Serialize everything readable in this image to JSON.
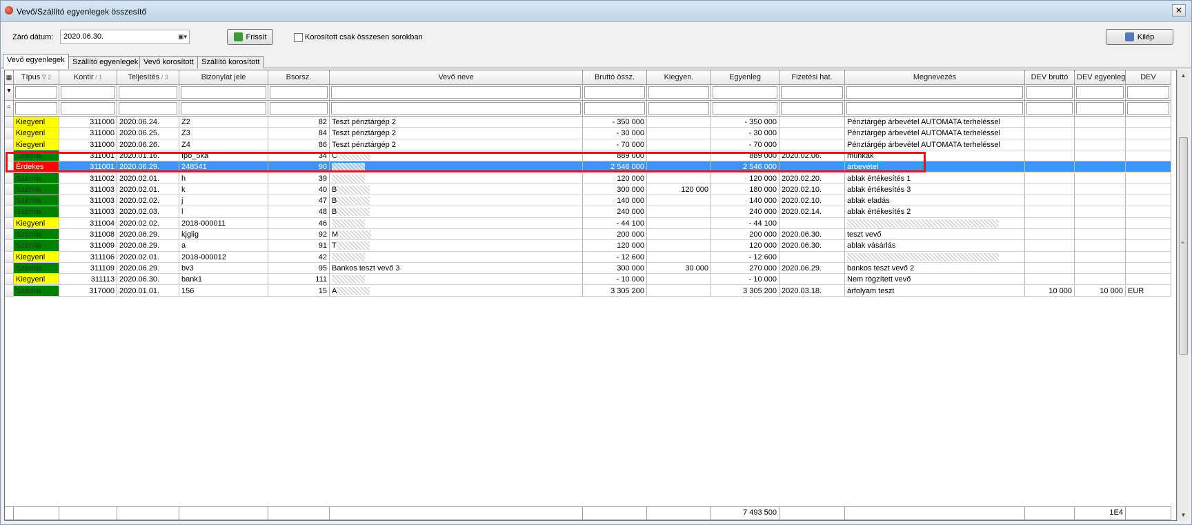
{
  "window": {
    "title": "Vevő/Szállító egyenlegek összesítő",
    "close": "✕"
  },
  "toolbar": {
    "date_label": "Záró dátum:",
    "date_value": "2020.06.30.",
    "refresh_label": "Frissít",
    "aged_only_label": "Korosított csak összesen sorokban",
    "exit_label": "Kilép"
  },
  "tabs": [
    "Vevő egyenlegek",
    "Szállító egyenlegek",
    "Vevő korosított",
    "Szállító korosított"
  ],
  "grid": {
    "columns": [
      {
        "label": "Típus",
        "sort": "∇ 2"
      },
      {
        "label": "Kontir",
        "sort": "/ 1"
      },
      {
        "label": "Teljesítés",
        "sort": "/ 3"
      },
      {
        "label": "Bizonylat jele",
        "sort": ""
      },
      {
        "label": "Bsorsz.",
        "sort": ""
      },
      {
        "label": "Vevő neve",
        "sort": ""
      },
      {
        "label": "Bruttó össz.",
        "sort": ""
      },
      {
        "label": "Kiegyen.",
        "sort": ""
      },
      {
        "label": "Egyenleg",
        "sort": ""
      },
      {
        "label": "Fizetési hat.",
        "sort": ""
      },
      {
        "label": "Megnevezés",
        "sort": ""
      },
      {
        "label": "DEV bruttó",
        "sort": ""
      },
      {
        "label": "DEV egyenleg",
        "sort": ""
      },
      {
        "label": "DEV",
        "sort": ""
      }
    ],
    "rows": [
      {
        "type": "Kiegyenl",
        "kind": "kiegyenl",
        "kontir": "311000",
        "date": "2020.06.24.",
        "doc": "Z2",
        "bsorsz": "82",
        "customer": "Teszt pénztárgép 2",
        "brutto": "- 350 000",
        "kiegyen": "",
        "egyenleg": "- 350 000",
        "due": "",
        "desc": "Pénztárgép árbevétel AUTOMATA terheléssel",
        "dev_brutto": "",
        "dev_egyenleg": "",
        "dev": ""
      },
      {
        "type": "Kiegyenl",
        "kind": "kiegyenl",
        "kontir": "311000",
        "date": "2020.06.25.",
        "doc": "Z3",
        "bsorsz": "84",
        "customer": "Teszt pénztárgép 2",
        "brutto": "- 30 000",
        "kiegyen": "",
        "egyenleg": "- 30 000",
        "due": "",
        "desc": "Pénztárgép árbevétel AUTOMATA terheléssel",
        "dev_brutto": "",
        "dev_egyenleg": "",
        "dev": ""
      },
      {
        "type": "Kiegyenl",
        "kind": "kiegyenl",
        "kontir": "311000",
        "date": "2020.06.26.",
        "doc": "Z4",
        "bsorsz": "86",
        "customer": "Teszt pénztárgép 2",
        "brutto": "- 70 000",
        "kiegyen": "",
        "egyenleg": "- 70 000",
        "due": "",
        "desc": "Pénztárgép árbevétel AUTOMATA terheléssel",
        "dev_brutto": "",
        "dev_egyenleg": "",
        "dev": ""
      },
      {
        "type": "Számla",
        "kind": "szamla",
        "kontir": "311001",
        "date": "2020.01.16.",
        "doc": "Ipo_5ka",
        "bsorsz": "34",
        "customer": "C",
        "brutto": "889 000",
        "kiegyen": "",
        "egyenleg": "889 000",
        "due": "2020.02.06.",
        "desc": "munkák",
        "dev_brutto": "",
        "dev_egyenleg": "",
        "dev": ""
      },
      {
        "type": "Érdekes",
        "kind": "erdekes",
        "selected": true,
        "kontir": "311001",
        "date": "2020.06.29.",
        "doc": "248541",
        "bsorsz": "90",
        "customer": "",
        "brutto": "2 546 000",
        "kiegyen": "",
        "egyenleg": "2 546 000",
        "due": "",
        "desc": "árbevétel",
        "dev_brutto": "",
        "dev_egyenleg": "",
        "dev": ""
      },
      {
        "type": "Számla",
        "kind": "szamla",
        "kontir": "311002",
        "date": "2020.02.01.",
        "doc": "h",
        "bsorsz": "39",
        "customer": "",
        "brutto": "120 000",
        "kiegyen": "",
        "egyenleg": "120 000",
        "due": "2020.02.20.",
        "desc": "ablak értékesítés 1",
        "dev_brutto": "",
        "dev_egyenleg": "",
        "dev": ""
      },
      {
        "type": "Számla",
        "kind": "szamla",
        "kontir": "311003",
        "date": "2020.02.01.",
        "doc": "k",
        "bsorsz": "40",
        "customer": "B",
        "brutto": "300 000",
        "kiegyen": "120 000",
        "egyenleg": "180 000",
        "due": "2020.02.10.",
        "desc": "ablak értékesítés 3",
        "dev_brutto": "",
        "dev_egyenleg": "",
        "dev": ""
      },
      {
        "type": "Számla",
        "kind": "szamla",
        "kontir": "311003",
        "date": "2020.02.02.",
        "doc": "j",
        "bsorsz": "47",
        "customer": "B",
        "brutto": "140 000",
        "kiegyen": "",
        "egyenleg": "140 000",
        "due": "2020.02.10.",
        "desc": "ablak eladás",
        "dev_brutto": "",
        "dev_egyenleg": "",
        "dev": ""
      },
      {
        "type": "Számla",
        "kind": "szamla",
        "kontir": "311003",
        "date": "2020.02.03.",
        "doc": "l",
        "bsorsz": "48",
        "customer": "B",
        "brutto": "240 000",
        "kiegyen": "",
        "egyenleg": "240 000",
        "due": "2020.02.14.",
        "desc": "ablak értékesítés 2",
        "dev_brutto": "",
        "dev_egyenleg": "",
        "dev": ""
      },
      {
        "type": "Kiegyenl",
        "kind": "kiegyenl",
        "kontir": "311004",
        "date": "2020.02.02.",
        "doc": "2018-000011",
        "bsorsz": "46",
        "customer": "",
        "brutto": "- 44 100",
        "kiegyen": "",
        "egyenleg": "- 44 100",
        "due": "",
        "desc": "",
        "desc_blur": true,
        "dev_brutto": "",
        "dev_egyenleg": "",
        "dev": ""
      },
      {
        "type": "Számla",
        "kind": "szamla",
        "kontir": "311008",
        "date": "2020.06.29.",
        "doc": "kjglig",
        "bsorsz": "92",
        "customer": "M",
        "brutto": "200 000",
        "kiegyen": "",
        "egyenleg": "200 000",
        "due": "2020.06.30.",
        "desc": "teszt vevő",
        "dev_brutto": "",
        "dev_egyenleg": "",
        "dev": ""
      },
      {
        "type": "Számla",
        "kind": "szamla",
        "kontir": "311009",
        "date": "2020.06.29.",
        "doc": "a",
        "bsorsz": "91",
        "customer": "T",
        "brutto": "120 000",
        "kiegyen": "",
        "egyenleg": "120 000",
        "due": "2020.06.30.",
        "desc": "ablak vásárlás",
        "dev_brutto": "",
        "dev_egyenleg": "",
        "dev": ""
      },
      {
        "type": "Kiegyenl",
        "kind": "kiegyenl",
        "kontir": "311106",
        "date": "2020.02.01.",
        "doc": "2018-000012",
        "bsorsz": "42",
        "customer": "",
        "brutto": "- 12 600",
        "kiegyen": "",
        "egyenleg": "- 12 600",
        "due": "",
        "desc": "",
        "desc_blur": true,
        "dev_brutto": "",
        "dev_egyenleg": "",
        "dev": ""
      },
      {
        "type": "Számla",
        "kind": "szamla",
        "kontir": "311109",
        "date": "2020.06.29.",
        "doc": "bv3",
        "bsorsz": "95",
        "customer": "Bankos teszt vevő 3",
        "brutto": "300 000",
        "kiegyen": "30 000",
        "egyenleg": "270 000",
        "due": "2020.06.29.",
        "desc": "bankos teszt vevő 2",
        "dev_brutto": "",
        "dev_egyenleg": "",
        "dev": ""
      },
      {
        "type": "Kiegyenl",
        "kind": "kiegyenl",
        "kontir": "311113",
        "date": "2020.06.30.",
        "doc": "bank1",
        "bsorsz": "111",
        "customer": "",
        "brutto": "- 10 000",
        "kiegyen": "",
        "egyenleg": "- 10 000",
        "due": "",
        "desc": "Nem rögzített vevő",
        "dev_brutto": "",
        "dev_egyenleg": "",
        "dev": ""
      },
      {
        "type": "Számla",
        "kind": "szamla",
        "kontir": "317000",
        "date": "2020.01.01.",
        "doc": "156",
        "bsorsz": "15",
        "customer": "A",
        "brutto": "3 305 200",
        "kiegyen": "",
        "egyenleg": "3 305 200",
        "due": "2020.03.18.",
        "desc": "árfolyam teszt",
        "dev_brutto": "10 000",
        "dev_egyenleg": "10 000",
        "dev": "EUR"
      }
    ],
    "footer": {
      "egyenleg_total": "7 493 500",
      "dev_egyenleg_total": "1E4"
    }
  },
  "colors": {
    "kiegyenl": "#ffff00",
    "szamla": "#008000",
    "erdekes": "#ff0000",
    "selection": "#3399ff",
    "highlight_box": "#e8101a"
  }
}
